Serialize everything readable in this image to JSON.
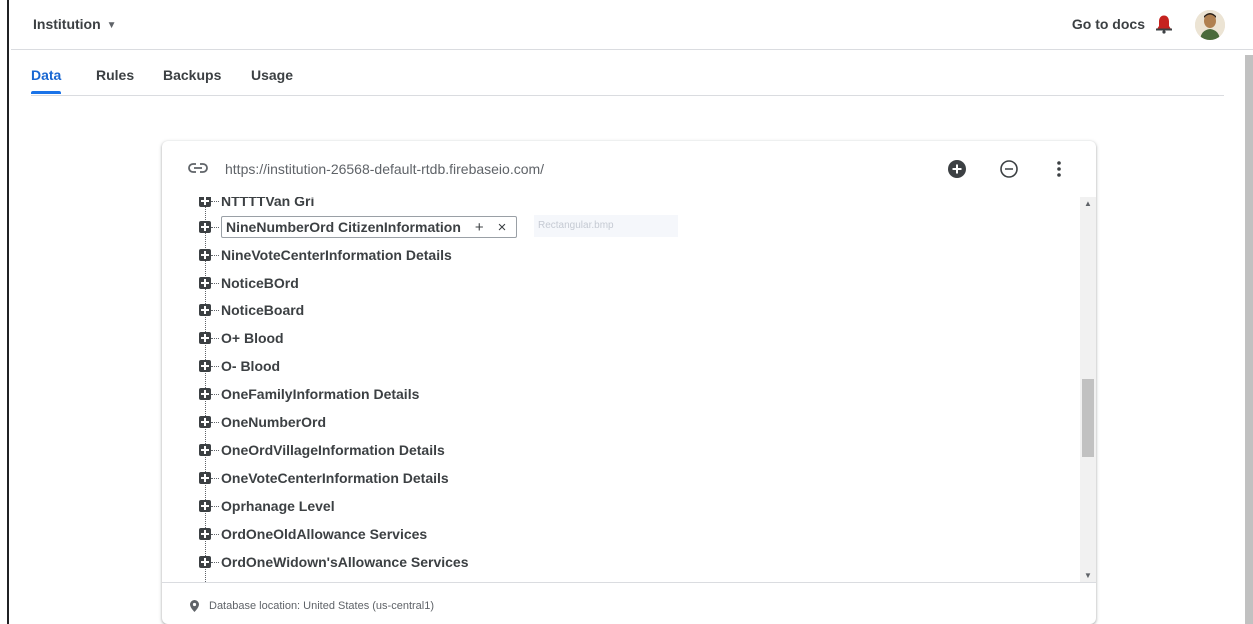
{
  "header": {
    "project_name": "Institution",
    "docs_link": "Go to docs",
    "icons": {
      "dropdown": "caret-down-icon",
      "notifications": "bell-icon",
      "account": "avatar"
    }
  },
  "tabs": [
    {
      "label": "Data",
      "active": true
    },
    {
      "label": "Rules",
      "active": false
    },
    {
      "label": "Backups",
      "active": false
    },
    {
      "label": "Usage",
      "active": false
    }
  ],
  "database": {
    "url": "https://institution-26568-default-rtdb.firebaseio.com/",
    "header_icons": [
      "link-icon",
      "add-circle-icon",
      "remove-circle-icon",
      "more-vert-icon"
    ],
    "editing_node": {
      "key": "NineNumberOrd CitizenInformation",
      "add_label": "+",
      "remove_label": "×",
      "ghost_value": "Rectangular.bmp"
    },
    "nodes": [
      "NTTTTVan Gri",
      "NineNumberOrd CitizenInformation",
      "NineVoteCenterInformation Details",
      "NoticeBOrd",
      "NoticeBoard",
      "O+ Blood",
      "O- Blood",
      "OneFamilyInformation Details",
      "OneNumberOrd",
      "OneOrdVillageInformation Details",
      "OneVoteCenterInformation Details",
      "Oprhanage Level",
      "OrdOneOldAllowance Services",
      "OrdOneWidown'sAllowance Services"
    ],
    "footer": "Database location: United States (us-central1)"
  },
  "colors": {
    "accent": "#1a73e8",
    "text": "#3c4043",
    "muted": "#5f6368",
    "bell": "#c5221f"
  }
}
